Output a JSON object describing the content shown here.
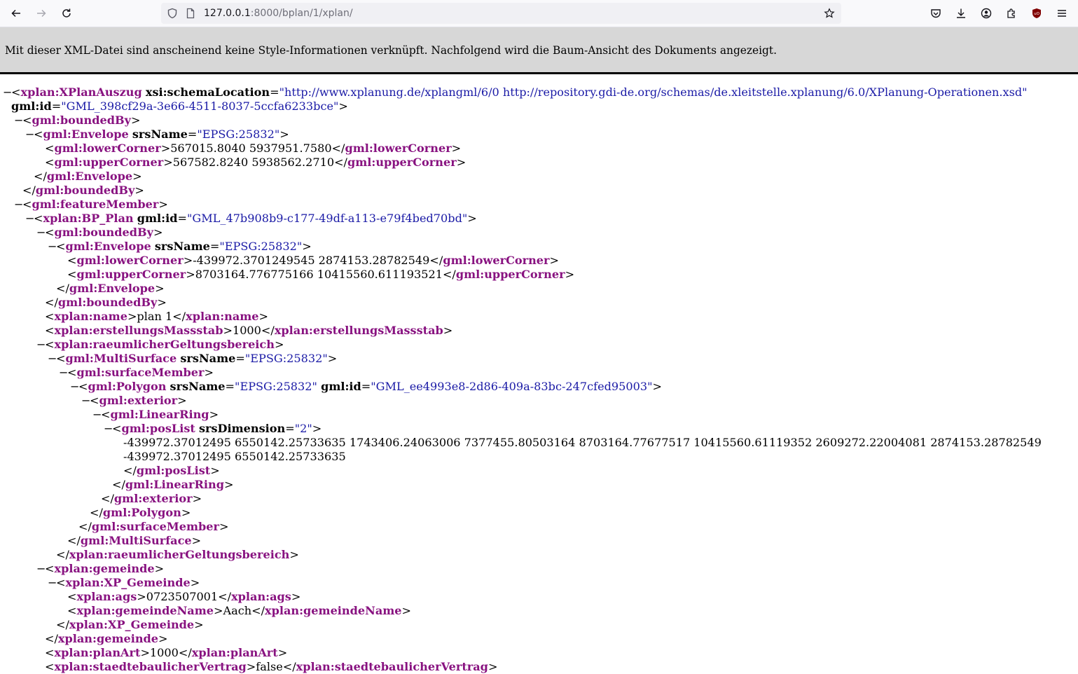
{
  "browser": {
    "url_host": "127.0.0.1",
    "url_rest": ":8000/bplan/1/xplan/"
  },
  "banner": {
    "message": "Mit dieser XML-Datei sind anscheinend keine Style-Informationen verknüpft. Nachfolgend wird die Baum-Ansicht des Dokuments angezeigt."
  },
  "xml_lines": [
    {
      "d": 0,
      "tw": true,
      "p": [
        [
          "p",
          "<"
        ],
        [
          "t",
          "xplan:XPlanAuszug"
        ],
        [
          "p",
          " "
        ],
        [
          "a",
          "xsi:schemaLocation"
        ],
        [
          "p",
          "="
        ],
        [
          "v",
          "\"http://www.xplanung.de/xplangml/6/0 http://repository.gdi-de.org/schemas/de.xleitstelle.xplanung/6.0/XPlanung-Operationen.xsd\""
        ]
      ]
    },
    {
      "d": 0,
      "tw": false,
      "p": [
        [
          "a",
          "gml:id"
        ],
        [
          "p",
          "="
        ],
        [
          "v",
          "\"GML_398cf29a-3e66-4511-8037-5ccfa6233bce\""
        ],
        [
          "p",
          ">"
        ]
      ]
    },
    {
      "d": 1,
      "tw": true,
      "p": [
        [
          "p",
          "<"
        ],
        [
          "t",
          "gml:boundedBy"
        ],
        [
          "p",
          ">"
        ]
      ]
    },
    {
      "d": 2,
      "tw": true,
      "p": [
        [
          "p",
          "<"
        ],
        [
          "t",
          "gml:Envelope"
        ],
        [
          "p",
          " "
        ],
        [
          "a",
          "srsName"
        ],
        [
          "p",
          "="
        ],
        [
          "v",
          "\"EPSG:25832\""
        ],
        [
          "p",
          ">"
        ]
      ]
    },
    {
      "d": 3,
      "tw": false,
      "p": [
        [
          "p",
          "<"
        ],
        [
          "t",
          "gml:lowerCorner"
        ],
        [
          "p",
          ">567015.8040 5937951.7580</"
        ],
        [
          "t",
          "gml:lowerCorner"
        ],
        [
          "p",
          ">"
        ]
      ]
    },
    {
      "d": 3,
      "tw": false,
      "p": [
        [
          "p",
          "<"
        ],
        [
          "t",
          "gml:upperCorner"
        ],
        [
          "p",
          ">567582.8240 5938562.2710</"
        ],
        [
          "t",
          "gml:upperCorner"
        ],
        [
          "p",
          ">"
        ]
      ]
    },
    {
      "d": 2,
      "tw": false,
      "p": [
        [
          "p",
          "</"
        ],
        [
          "t",
          "gml:Envelope"
        ],
        [
          "p",
          ">"
        ]
      ]
    },
    {
      "d": 1,
      "tw": false,
      "p": [
        [
          "p",
          "</"
        ],
        [
          "t",
          "gml:boundedBy"
        ],
        [
          "p",
          ">"
        ]
      ]
    },
    {
      "d": 1,
      "tw": true,
      "p": [
        [
          "p",
          "<"
        ],
        [
          "t",
          "gml:featureMember"
        ],
        [
          "p",
          ">"
        ]
      ]
    },
    {
      "d": 2,
      "tw": true,
      "p": [
        [
          "p",
          "<"
        ],
        [
          "t",
          "xplan:BP_Plan"
        ],
        [
          "p",
          " "
        ],
        [
          "a",
          "gml:id"
        ],
        [
          "p",
          "="
        ],
        [
          "v",
          "\"GML_47b908b9-c177-49df-a113-e79f4bed70bd\""
        ],
        [
          "p",
          ">"
        ]
      ]
    },
    {
      "d": 3,
      "tw": true,
      "p": [
        [
          "p",
          "<"
        ],
        [
          "t",
          "gml:boundedBy"
        ],
        [
          "p",
          ">"
        ]
      ]
    },
    {
      "d": 4,
      "tw": true,
      "p": [
        [
          "p",
          "<"
        ],
        [
          "t",
          "gml:Envelope"
        ],
        [
          "p",
          " "
        ],
        [
          "a",
          "srsName"
        ],
        [
          "p",
          "="
        ],
        [
          "v",
          "\"EPSG:25832\""
        ],
        [
          "p",
          ">"
        ]
      ]
    },
    {
      "d": 5,
      "tw": false,
      "p": [
        [
          "p",
          "<"
        ],
        [
          "t",
          "gml:lowerCorner"
        ],
        [
          "p",
          ">-439972.3701249545 2874153.28782549</"
        ],
        [
          "t",
          "gml:lowerCorner"
        ],
        [
          "p",
          ">"
        ]
      ]
    },
    {
      "d": 5,
      "tw": false,
      "p": [
        [
          "p",
          "<"
        ],
        [
          "t",
          "gml:upperCorner"
        ],
        [
          "p",
          ">8703164.776775166 10415560.611193521</"
        ],
        [
          "t",
          "gml:upperCorner"
        ],
        [
          "p",
          ">"
        ]
      ]
    },
    {
      "d": 4,
      "tw": false,
      "p": [
        [
          "p",
          "</"
        ],
        [
          "t",
          "gml:Envelope"
        ],
        [
          "p",
          ">"
        ]
      ]
    },
    {
      "d": 3,
      "tw": false,
      "p": [
        [
          "p",
          "</"
        ],
        [
          "t",
          "gml:boundedBy"
        ],
        [
          "p",
          ">"
        ]
      ]
    },
    {
      "d": 3,
      "tw": false,
      "p": [
        [
          "p",
          "<"
        ],
        [
          "t",
          "xplan:name"
        ],
        [
          "p",
          ">plan 1</"
        ],
        [
          "t",
          "xplan:name"
        ],
        [
          "p",
          ">"
        ]
      ]
    },
    {
      "d": 3,
      "tw": false,
      "p": [
        [
          "p",
          "<"
        ],
        [
          "t",
          "xplan:erstellungsMassstab"
        ],
        [
          "p",
          ">1000</"
        ],
        [
          "t",
          "xplan:erstellungsMassstab"
        ],
        [
          "p",
          ">"
        ]
      ]
    },
    {
      "d": 3,
      "tw": true,
      "p": [
        [
          "p",
          "<"
        ],
        [
          "t",
          "xplan:raeumlicherGeltungsbereich"
        ],
        [
          "p",
          ">"
        ]
      ]
    },
    {
      "d": 4,
      "tw": true,
      "p": [
        [
          "p",
          "<"
        ],
        [
          "t",
          "gml:MultiSurface"
        ],
        [
          "p",
          " "
        ],
        [
          "a",
          "srsName"
        ],
        [
          "p",
          "="
        ],
        [
          "v",
          "\"EPSG:25832\""
        ],
        [
          "p",
          ">"
        ]
      ]
    },
    {
      "d": 5,
      "tw": true,
      "p": [
        [
          "p",
          "<"
        ],
        [
          "t",
          "gml:surfaceMember"
        ],
        [
          "p",
          ">"
        ]
      ]
    },
    {
      "d": 6,
      "tw": true,
      "p": [
        [
          "p",
          "<"
        ],
        [
          "t",
          "gml:Polygon"
        ],
        [
          "p",
          " "
        ],
        [
          "a",
          "srsName"
        ],
        [
          "p",
          "="
        ],
        [
          "v",
          "\"EPSG:25832\""
        ],
        [
          "p",
          " "
        ],
        [
          "a",
          "gml:id"
        ],
        [
          "p",
          "="
        ],
        [
          "v",
          "\"GML_ee4993e8-2d86-409a-83bc-247cfed95003\""
        ],
        [
          "p",
          ">"
        ]
      ]
    },
    {
      "d": 7,
      "tw": true,
      "p": [
        [
          "p",
          "<"
        ],
        [
          "t",
          "gml:exterior"
        ],
        [
          "p",
          ">"
        ]
      ]
    },
    {
      "d": 8,
      "tw": true,
      "p": [
        [
          "p",
          "<"
        ],
        [
          "t",
          "gml:LinearRing"
        ],
        [
          "p",
          ">"
        ]
      ]
    },
    {
      "d": 9,
      "tw": true,
      "p": [
        [
          "p",
          "<"
        ],
        [
          "t",
          "gml:posList"
        ],
        [
          "p",
          " "
        ],
        [
          "a",
          "srsDimension"
        ],
        [
          "p",
          "="
        ],
        [
          "v",
          "\"2\""
        ],
        [
          "p",
          ">"
        ]
      ]
    },
    {
      "d": 10,
      "tw": false,
      "p": [
        [
          "p",
          "-439972.37012495 6550142.25733635 1743406.24063006 7377455.80503164 8703164.77677517 10415560.61119352 2609272.22004081 2874153.28782549"
        ]
      ]
    },
    {
      "d": 10,
      "tw": false,
      "p": [
        [
          "p",
          "-439972.37012495 6550142.25733635"
        ]
      ]
    },
    {
      "d": 10,
      "tw": false,
      "p": [
        [
          "p",
          "</"
        ],
        [
          "t",
          "gml:posList"
        ],
        [
          "p",
          ">"
        ]
      ]
    },
    {
      "d": 9,
      "tw": false,
      "p": [
        [
          "p",
          "</"
        ],
        [
          "t",
          "gml:LinearRing"
        ],
        [
          "p",
          ">"
        ]
      ]
    },
    {
      "d": 8,
      "tw": false,
      "p": [
        [
          "p",
          "</"
        ],
        [
          "t",
          "gml:exterior"
        ],
        [
          "p",
          ">"
        ]
      ]
    },
    {
      "d": 7,
      "tw": false,
      "p": [
        [
          "p",
          "</"
        ],
        [
          "t",
          "gml:Polygon"
        ],
        [
          "p",
          ">"
        ]
      ]
    },
    {
      "d": 6,
      "tw": false,
      "p": [
        [
          "p",
          "</"
        ],
        [
          "t",
          "gml:surfaceMember"
        ],
        [
          "p",
          ">"
        ]
      ]
    },
    {
      "d": 5,
      "tw": false,
      "p": [
        [
          "p",
          "</"
        ],
        [
          "t",
          "gml:MultiSurface"
        ],
        [
          "p",
          ">"
        ]
      ]
    },
    {
      "d": 4,
      "tw": false,
      "p": [
        [
          "p",
          "</"
        ],
        [
          "t",
          "xplan:raeumlicherGeltungsbereich"
        ],
        [
          "p",
          ">"
        ]
      ]
    },
    {
      "d": 3,
      "tw": true,
      "p": [
        [
          "p",
          "<"
        ],
        [
          "t",
          "xplan:gemeinde"
        ],
        [
          "p",
          ">"
        ]
      ]
    },
    {
      "d": 4,
      "tw": true,
      "p": [
        [
          "p",
          "<"
        ],
        [
          "t",
          "xplan:XP_Gemeinde"
        ],
        [
          "p",
          ">"
        ]
      ]
    },
    {
      "d": 5,
      "tw": false,
      "p": [
        [
          "p",
          "<"
        ],
        [
          "t",
          "xplan:ags"
        ],
        [
          "p",
          ">0723507001</"
        ],
        [
          "t",
          "xplan:ags"
        ],
        [
          "p",
          ">"
        ]
      ]
    },
    {
      "d": 5,
      "tw": false,
      "p": [
        [
          "p",
          "<"
        ],
        [
          "t",
          "xplan:gemeindeName"
        ],
        [
          "p",
          ">Aach</"
        ],
        [
          "t",
          "xplan:gemeindeName"
        ],
        [
          "p",
          ">"
        ]
      ]
    },
    {
      "d": 4,
      "tw": false,
      "p": [
        [
          "p",
          "</"
        ],
        [
          "t",
          "xplan:XP_Gemeinde"
        ],
        [
          "p",
          ">"
        ]
      ]
    },
    {
      "d": 3,
      "tw": false,
      "p": [
        [
          "p",
          "</"
        ],
        [
          "t",
          "xplan:gemeinde"
        ],
        [
          "p",
          ">"
        ]
      ]
    },
    {
      "d": 3,
      "tw": false,
      "p": [
        [
          "p",
          "<"
        ],
        [
          "t",
          "xplan:planArt"
        ],
        [
          "p",
          ">1000</"
        ],
        [
          "t",
          "xplan:planArt"
        ],
        [
          "p",
          ">"
        ]
      ]
    },
    {
      "d": 3,
      "tw": false,
      "p": [
        [
          "p",
          "<"
        ],
        [
          "t",
          "xplan:staedtebaulicherVertrag"
        ],
        [
          "p",
          ">false</"
        ],
        [
          "t",
          "xplan:staedtebaulicherVertrag"
        ],
        [
          "p",
          ">"
        ]
      ]
    }
  ]
}
